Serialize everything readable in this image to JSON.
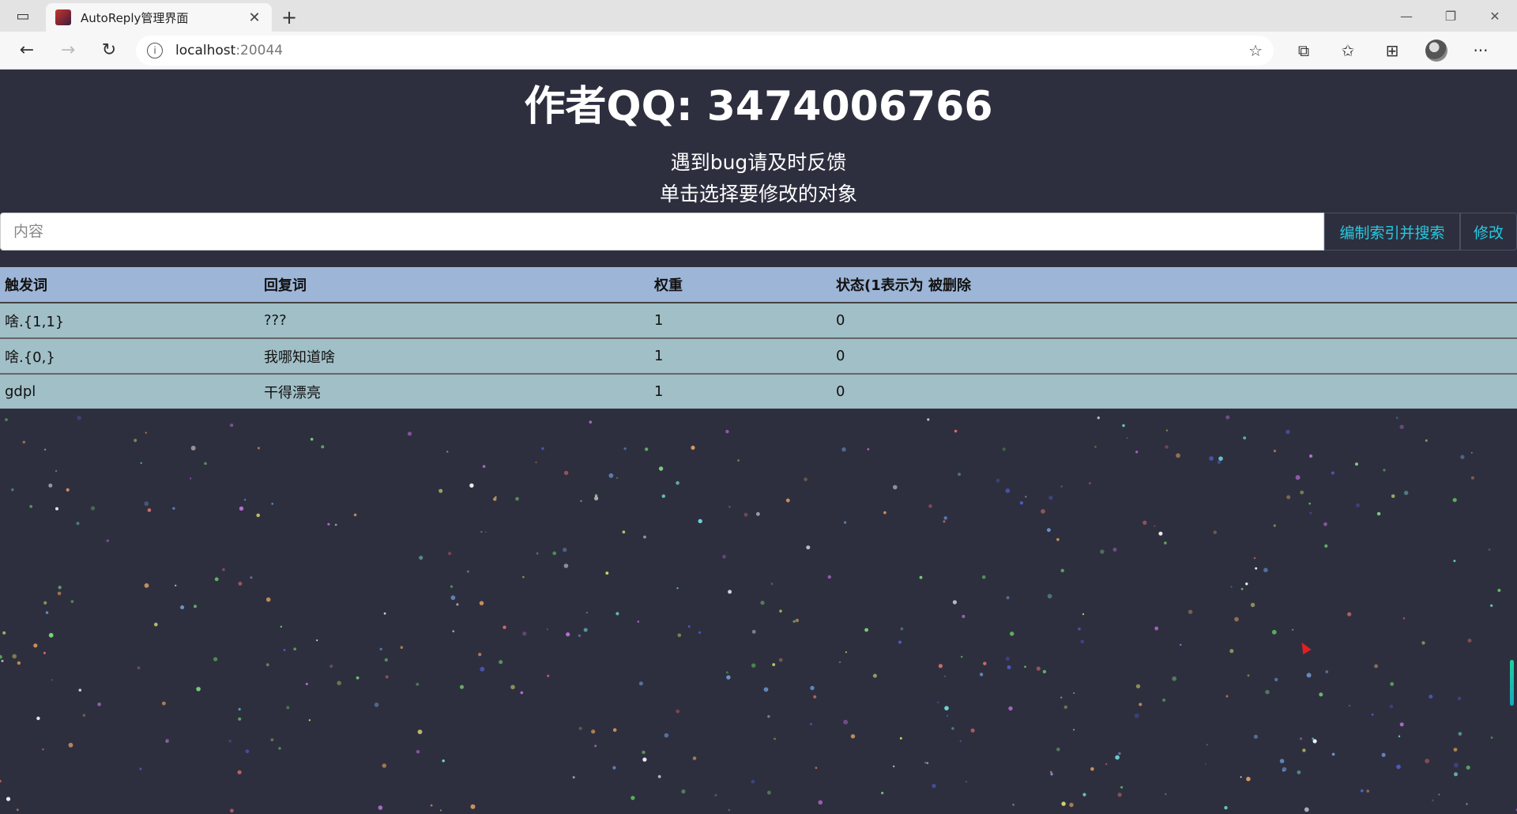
{
  "browser": {
    "tab_title": "AutoReply管理界面",
    "url_host": "localhost",
    "url_port": ":20044"
  },
  "page": {
    "author": "作者QQ: 3474006766",
    "notice": "遇到bug请及时反馈",
    "instruction": "单击选择要修改的对象",
    "search_placeholder": "内容",
    "index_search_label": "编制索引并搜索",
    "modify_label": "修改"
  },
  "table": {
    "headers": [
      "触发词",
      "回复词",
      "权重",
      "状态(1表示为 被删除"
    ],
    "rows": [
      [
        "啥.{1,1}",
        "???",
        "1",
        "0"
      ],
      [
        "啥.{0,}",
        "我哪知道啥",
        "1",
        "0"
      ],
      [
        "gdpl",
        "干得漂亮",
        "1",
        "0"
      ]
    ]
  },
  "colors": {
    "page_bg": "#2e2f3e",
    "button_text": "#25c9e0",
    "header_bg": "#9db5d6",
    "row_bg": "#a1bfc7"
  }
}
